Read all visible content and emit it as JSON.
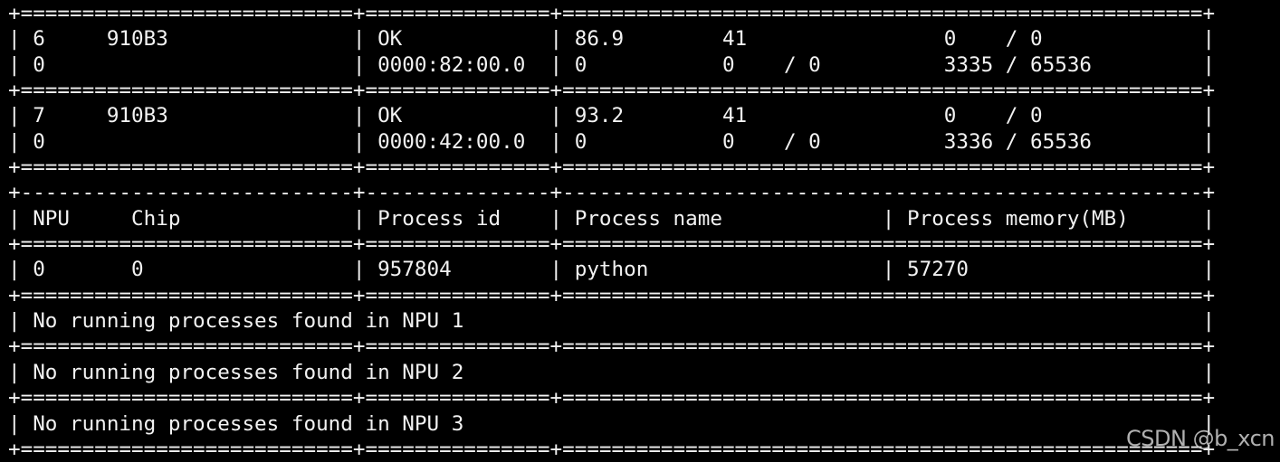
{
  "terminal": {
    "lines": [
      "+===========================+===============+====================================================+",
      "| 6     910B3               | OK            | 86.9        41                0    / 0             |",
      "| 0                         | 0000:82:00.0  | 0           0    / 0          3335 / 65536         |",
      "+===========================+===============+====================================================+",
      "| 7     910B3               | OK            | 93.2        41                0    / 0             |",
      "| 0                         | 0000:42:00.0  | 0           0    / 0          3336 / 65536         |",
      "+===========================+===============+====================================================+",
      "+---------------------------+---------------+----------------------------------------------------+",
      "| NPU     Chip              | Process id    | Process name             | Process memory(MB)      |",
      "+===========================+===============+====================================================+",
      "| 0       0                 | 957804        | python                   | 57270                   |",
      "+===========================+===============+====================================================+",
      "| No running processes found in NPU 1                                                            |",
      "+===========================+===============+====================================================+",
      "| No running processes found in NPU 2                                                            |",
      "+===========================+===============+====================================================+",
      "| No running processes found in NPU 3                                                            |",
      "+===========================+===============+====================================================+"
    ]
  },
  "watermark": "CSDN @b_xcn",
  "colors": {
    "background": "#000000",
    "text": "#f2f2f2"
  }
}
